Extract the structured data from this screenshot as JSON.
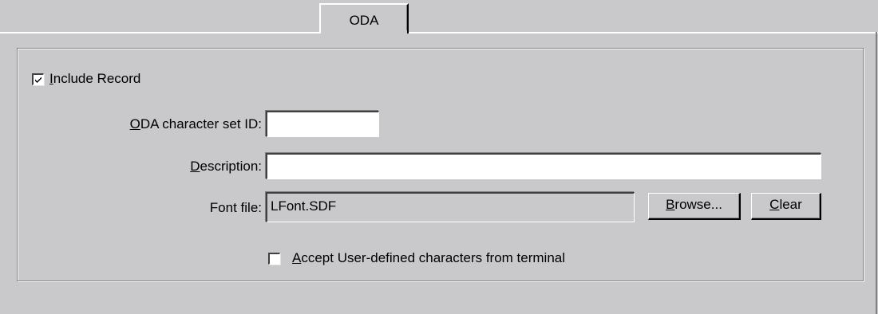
{
  "tab": {
    "label": "ODA"
  },
  "include_record": {
    "checked": true,
    "label_underline": "I",
    "label_rest": "nclude Record"
  },
  "oda_charset": {
    "label_underline": "O",
    "label_rest": "DA character set ID:",
    "value": ""
  },
  "description": {
    "label_underline": "D",
    "label_rest": "escription:",
    "value": ""
  },
  "font_file": {
    "label": "Font file:",
    "value": "LFont.SDF"
  },
  "browse_button": {
    "label_underline": "B",
    "label_rest": "rowse..."
  },
  "clear_button": {
    "label_underline": "C",
    "label_rest": "lear"
  },
  "accept_user_defined": {
    "checked": false,
    "label_underline": "A",
    "label_rest": "ccept User-defined characters from terminal"
  }
}
